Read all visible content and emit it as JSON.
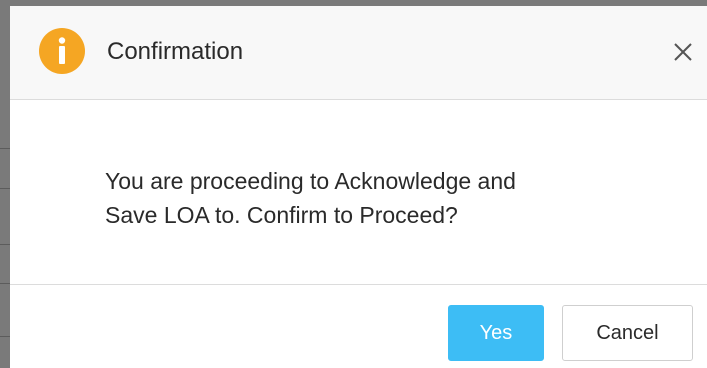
{
  "dialog": {
    "title": "Confirmation",
    "icon": "info-icon",
    "close_icon": "close-icon",
    "message_line1": "You are proceeding to Acknowledge and",
    "message_line2": "Save LOA to. Confirm to Proceed?",
    "buttons": {
      "yes_label": "Yes",
      "cancel_label": "Cancel"
    }
  },
  "colors": {
    "icon_orange": "#f5a623",
    "primary_button": "#3dbdf5",
    "backdrop": "#7a7a7a"
  }
}
